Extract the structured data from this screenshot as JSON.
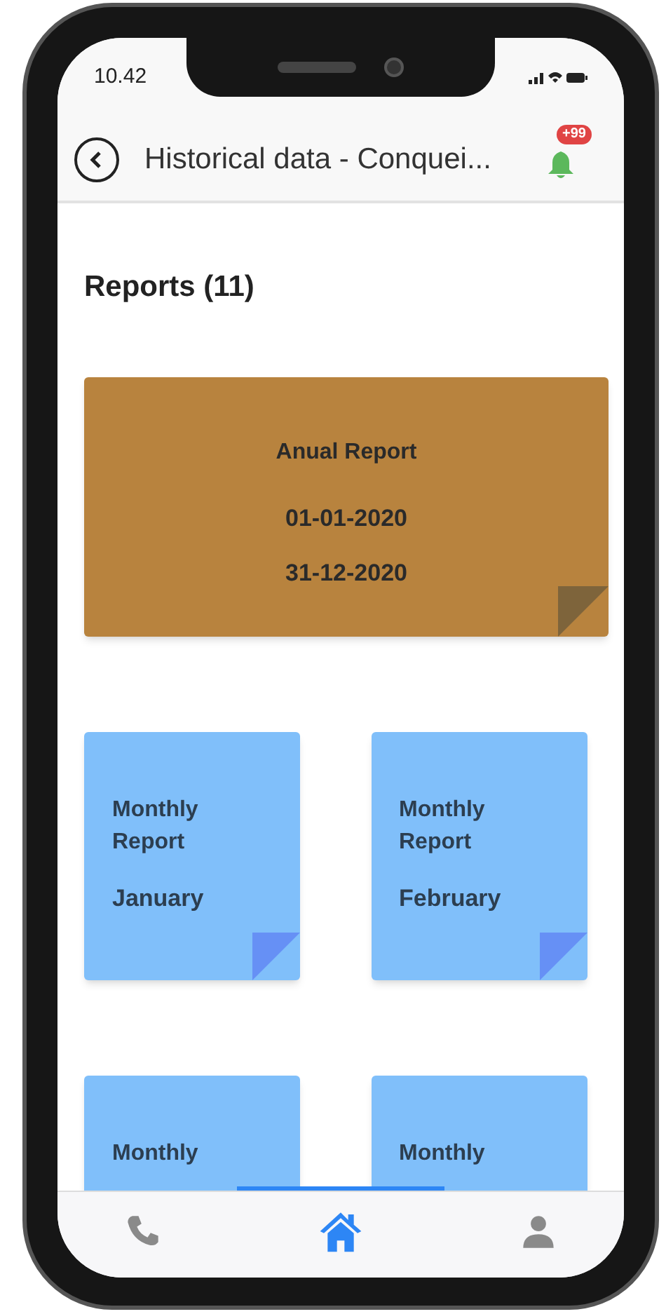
{
  "status_bar": {
    "time": "10.42"
  },
  "header": {
    "title": "Historical data - Conquei...",
    "notification_badge": "+99"
  },
  "section": {
    "title": "Reports (11)"
  },
  "reports": [
    {
      "kind": "annual",
      "title": "Anual Report",
      "lines": [
        "01-01-2020",
        "31-12-2020"
      ]
    },
    {
      "kind": "monthly",
      "title": "Monthly Report",
      "month": "January"
    },
    {
      "kind": "monthly",
      "title": "Monthly Report",
      "month": "February"
    },
    {
      "kind": "monthly",
      "title": "Monthly"
    },
    {
      "kind": "monthly",
      "title": "Monthly"
    }
  ],
  "bottom_nav": [
    {
      "kind": "phone",
      "selected": false
    },
    {
      "kind": "home",
      "selected": true
    },
    {
      "kind": "person",
      "selected": false
    }
  ]
}
